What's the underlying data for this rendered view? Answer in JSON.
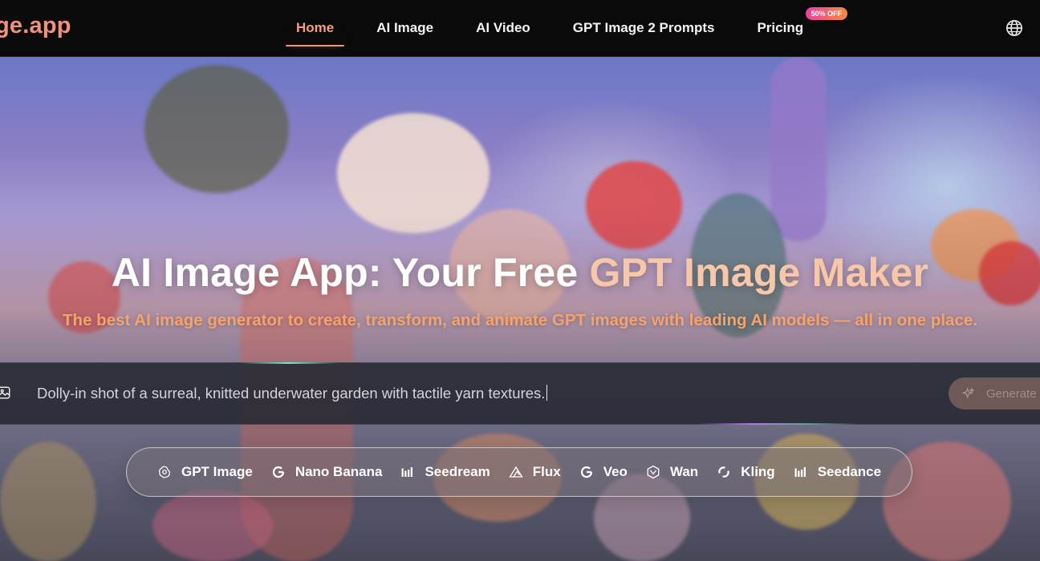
{
  "brand": {
    "logo_text": "ge.app"
  },
  "nav": {
    "items": [
      {
        "label": "Home",
        "active": true
      },
      {
        "label": "AI Image"
      },
      {
        "label": "AI Video"
      },
      {
        "label": "GPT Image 2 Prompts"
      },
      {
        "label": "Pricing",
        "badge": "50% OFF"
      }
    ],
    "language_icon": "globe-icon"
  },
  "hero": {
    "title_white": "AI Image App: Your Free ",
    "title_accent": "GPT Image Maker",
    "subtitle": "The best AI image generator to create, transform, and animate GPT images with leading AI models — all in one place."
  },
  "prompt": {
    "value": "Dolly-in shot of a surreal, knitted underwater garden with tactile yarn textures.",
    "generate_label": "Generate",
    "upload_icon": "image-upload-icon",
    "generate_icon": "sparkle-icon"
  },
  "models": [
    {
      "label": "GPT Image",
      "icon": "openai-icon"
    },
    {
      "label": "Nano Banana",
      "icon": "google-g-icon"
    },
    {
      "label": "Seedream",
      "icon": "bars-icon"
    },
    {
      "label": "Flux",
      "icon": "flux-triangle-icon"
    },
    {
      "label": "Veo",
      "icon": "google-g-icon"
    },
    {
      "label": "Wan",
      "icon": "wan-icon"
    },
    {
      "label": "Kling",
      "icon": "kling-icon"
    },
    {
      "label": "Seedance",
      "icon": "bars-icon"
    }
  ],
  "colors": {
    "accent": "#f0977a",
    "title_accent": "#f7c7a8",
    "subtitle": "#f5a36c",
    "badge_gradient": [
      "#ee3fa0",
      "#f58a3c"
    ]
  }
}
